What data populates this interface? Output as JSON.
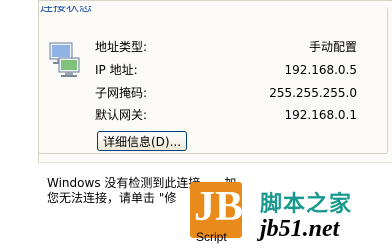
{
  "group": {
    "title": "连接状态"
  },
  "rows": [
    {
      "label": "地址类型:",
      "value": "手动配置"
    },
    {
      "label": "IP 地址:",
      "value": "192.168.0.5"
    },
    {
      "label": "子网掩码:",
      "value": "255.255.255.0"
    },
    {
      "label": "默认网关:",
      "value": "192.168.0.1"
    }
  ],
  "details_button": {
    "label": "详细信息(D)..."
  },
  "message": {
    "line1": "Windows 没有检测到此连接",
    "line1_tail": "加",
    "line2": "您无法连接，请单击 \"修"
  },
  "watermark": {
    "logo_text": "JB",
    "script": "Script",
    "brand_cn": "脚本之家",
    "url": "jb51.net"
  },
  "colors": {
    "accent": "#2456a6",
    "logo_orange": "#e88b1a",
    "brand_teal": "#1a9a8e"
  }
}
